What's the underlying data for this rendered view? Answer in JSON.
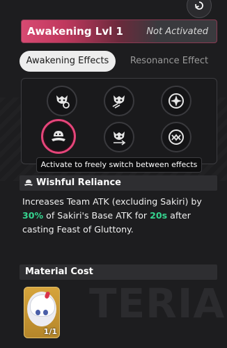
{
  "header": {
    "title": "Awakening Lvl 1",
    "status": "Not Activated",
    "accent_color": "#d74a72"
  },
  "tabs": [
    {
      "label": "Awakening Effects",
      "active": true
    },
    {
      "label": "Resonance Effect",
      "active": false
    }
  ],
  "effects": [
    {
      "icon": "monster-gear-icon",
      "selected": false
    },
    {
      "icon": "monster-claw-icon",
      "selected": false
    },
    {
      "icon": "star-badge-icon",
      "selected": false
    },
    {
      "icon": "blob-ribbon-icon",
      "selected": true
    },
    {
      "icon": "monster-arrow-icon",
      "selected": false
    },
    {
      "icon": "fanged-mouth-icon",
      "selected": false
    }
  ],
  "tooltip": "Activate to freely switch between effects",
  "skill": {
    "name": "Wishful Reliance",
    "icon": "blob-ribbon-icon",
    "description": {
      "part1": "Increases Team ATK (excluding Sakiri) by ",
      "value1": "30%",
      "part2": " of Sakiri's Base ATK for ",
      "value2": "20s",
      "part3": " after casting Feast of Gluttony."
    },
    "highlight_color": "#35d48f"
  },
  "material": {
    "title": "Material Cost",
    "items": [
      {
        "name": "sakiri-portrait",
        "count": "1/1"
      }
    ]
  },
  "background": {
    "watermark": "TERIALS"
  }
}
